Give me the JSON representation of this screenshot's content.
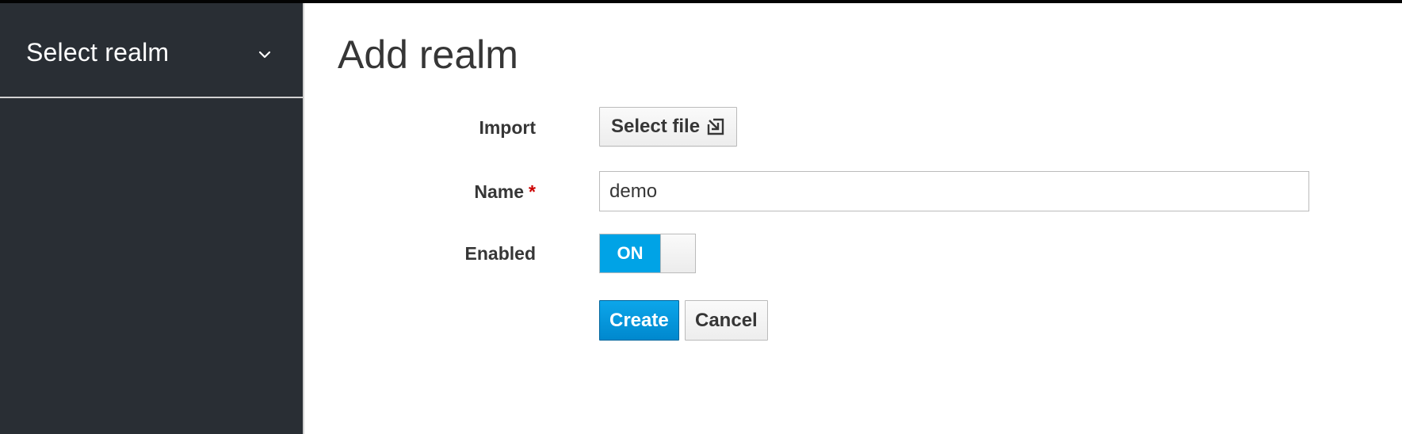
{
  "sidebar": {
    "realm_selector_label": "Select realm",
    "realm_selector_icon": "chevron-down-icon"
  },
  "main": {
    "title": "Add realm"
  },
  "form": {
    "import": {
      "label": "Import",
      "button_label": "Select file",
      "button_icon": "import-icon"
    },
    "name": {
      "label": "Name",
      "required_marker": "*",
      "value": "demo"
    },
    "enabled": {
      "label": "Enabled",
      "toggle_text": "ON",
      "state": true
    },
    "actions": {
      "create_label": "Create",
      "cancel_label": "Cancel"
    }
  },
  "colors": {
    "sidebar_bg": "#292e34",
    "accent_blue": "#0088ce",
    "toggle_on": "#00a3e6",
    "required_red": "#cc0000",
    "text_dark": "#363636"
  }
}
